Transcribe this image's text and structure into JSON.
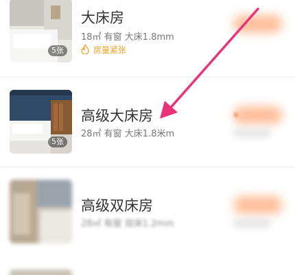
{
  "rooms": [
    {
      "name": "大床房",
      "details": "18㎡ 有窗 大床1.8mm",
      "photo_count": "5张",
      "urgency": "房量紧张"
    },
    {
      "name": "高级大床房",
      "details": "28㎡ 有窗 大床1.8米m",
      "photo_count": "5张",
      "price_visible": "¥"
    },
    {
      "name": "高级双床房",
      "details": "28㎡ 有窗 双床1.2mm"
    }
  ],
  "colors": {
    "accent_arrow": "#e8327a",
    "urgency": "#f0a020",
    "price": "#ff7a3a"
  },
  "icons": {
    "urgency_icon": "fire-icon",
    "annotation": "arrow-annotation"
  }
}
